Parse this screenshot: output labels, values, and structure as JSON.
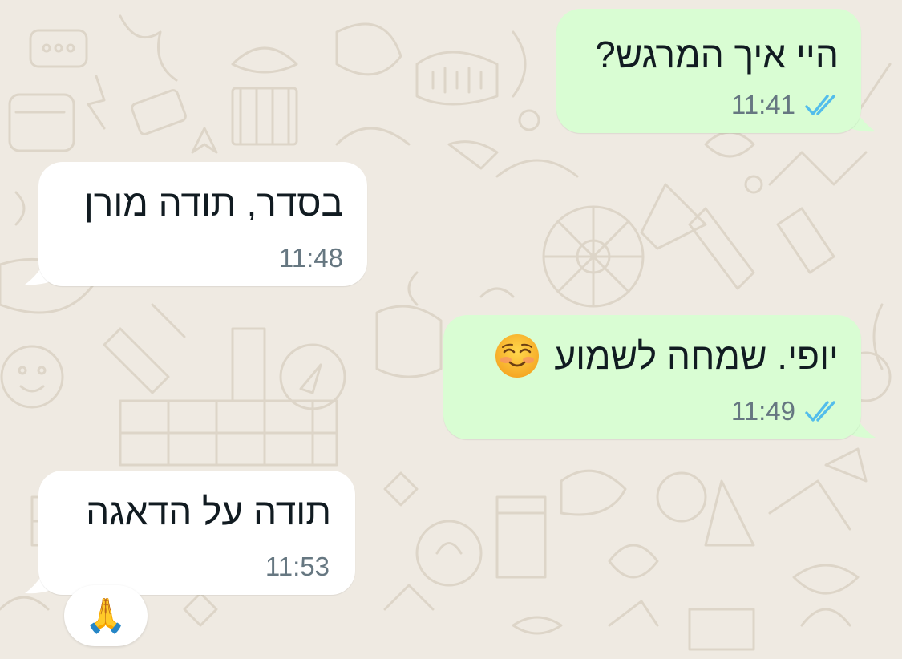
{
  "messages": [
    {
      "direction": "outgoing",
      "text": "היי איך המרגש?",
      "time": "11:41",
      "status": "read"
    },
    {
      "direction": "incoming",
      "text": "בסדר, תודה מורן",
      "time": "11:48"
    },
    {
      "direction": "outgoing",
      "text": "יופי. שמחה לשמוע",
      "emoji": "smiling-face-icon",
      "time": "11:49",
      "status": "read"
    },
    {
      "direction": "incoming",
      "text": "תודה על הדאגה",
      "time": "11:53",
      "reaction": "🙏"
    }
  ],
  "colors": {
    "wallpaper": "#efeae2",
    "outgoing_bubble": "#d9fdd3",
    "incoming_bubble": "#ffffff",
    "read_tick": "#53bdeb",
    "meta_text": "#667781"
  }
}
